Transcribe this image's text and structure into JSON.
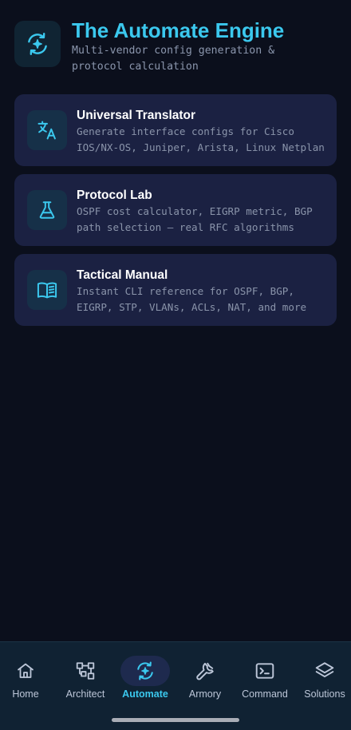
{
  "header": {
    "title": "The Automate Engine",
    "subtitle": "Multi-vendor config generation & protocol calculation",
    "logo_icon": "automate-sparkle-icon"
  },
  "cards": [
    {
      "title": "Universal Translator",
      "description": "Generate interface configs for Cisco IOS/NX-OS, Juniper, Arista, Linux Netplan",
      "icon": "translate-icon"
    },
    {
      "title": "Protocol Lab",
      "description": "OSPF cost calculator, EIGRP metric, BGP path selection — real RFC algorithms",
      "icon": "flask-icon"
    },
    {
      "title": "Tactical Manual",
      "description": "Instant CLI reference for OSPF, BGP, EIGRP, STP, VLANs, ACLs, NAT, and more",
      "icon": "book-icon"
    }
  ],
  "nav": {
    "active": "Automate",
    "items": [
      {
        "label": "Home",
        "icon": "home-icon"
      },
      {
        "label": "Architect",
        "icon": "topology-icon"
      },
      {
        "label": "Automate",
        "icon": "automate-sparkle-icon"
      },
      {
        "label": "Armory",
        "icon": "wrench-icon"
      },
      {
        "label": "Command",
        "icon": "terminal-icon"
      },
      {
        "label": "Solutions",
        "icon": "layers-icon"
      }
    ]
  },
  "colors": {
    "background": "#0b0f1c",
    "accent": "#3bc8ee",
    "card": "#1b2142",
    "nav_background": "#102233"
  }
}
